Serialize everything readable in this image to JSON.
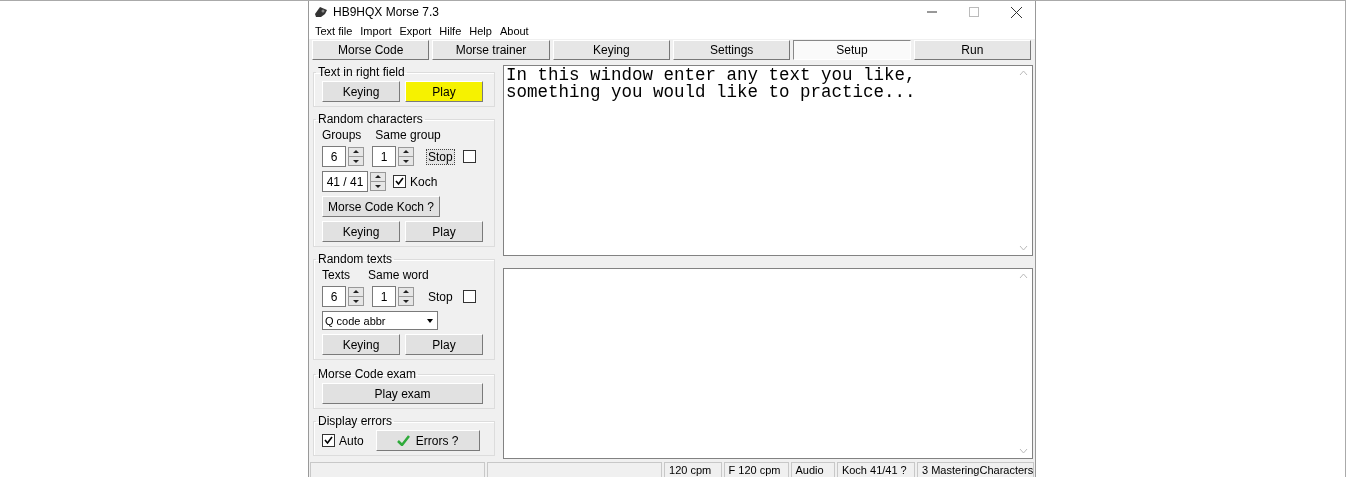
{
  "window": {
    "title": "HB9HQX Morse 7.3"
  },
  "menu": [
    "Text file",
    "Import",
    "Export",
    "Hilfe",
    "Help",
    "About"
  ],
  "tabs": [
    {
      "label": "Morse Code",
      "selected": false
    },
    {
      "label": "Morse trainer",
      "selected": false
    },
    {
      "label": "Keying",
      "selected": false
    },
    {
      "label": "Settings",
      "selected": false
    },
    {
      "label": "Setup",
      "selected": true
    },
    {
      "label": "Run",
      "selected": false
    }
  ],
  "text_in_right_field": {
    "title": "Text in right field",
    "buttons": [
      {
        "label": "Keying",
        "highlighted": false
      },
      {
        "label": "Play",
        "highlighted": true
      }
    ]
  },
  "random_characters": {
    "title": "Random characters",
    "groups_label": "Groups",
    "same_group_label": "Same group",
    "groups_value": "6",
    "same_group_value": "1",
    "stop": {
      "label": "Stop",
      "checked": false,
      "focused": true
    },
    "koch_value": "41 / 41",
    "koch": {
      "label": "Koch",
      "checked": true
    },
    "koch_button": "Morse Code Koch ?",
    "buttons": [
      {
        "label": "Keying",
        "highlighted": false
      },
      {
        "label": "Play",
        "highlighted": false
      }
    ]
  },
  "random_texts": {
    "title": "Random texts",
    "texts_label": "Texts",
    "same_word_label": "Same word",
    "texts_value": "6",
    "same_word_value": "1",
    "stop": {
      "label": "Stop",
      "checked": false,
      "focused": false
    },
    "select": "Q code abbr",
    "buttons": [
      {
        "label": "Keying",
        "highlighted": false
      },
      {
        "label": "Play",
        "highlighted": false
      }
    ]
  },
  "exam": {
    "title": "Morse Code exam",
    "button": "Play exam"
  },
  "display_errors": {
    "title": "Display errors",
    "auto": {
      "label": "Auto",
      "checked": true
    },
    "button": "Errors ?"
  },
  "text_field": {
    "value": "In this window enter any text you like,\nsomething you would like to practice..."
  },
  "status_bar": [
    "120 cpm",
    "F 120 cpm",
    "Audio",
    "Koch 41/41  ?",
    "3 MasteringCharacters"
  ]
}
